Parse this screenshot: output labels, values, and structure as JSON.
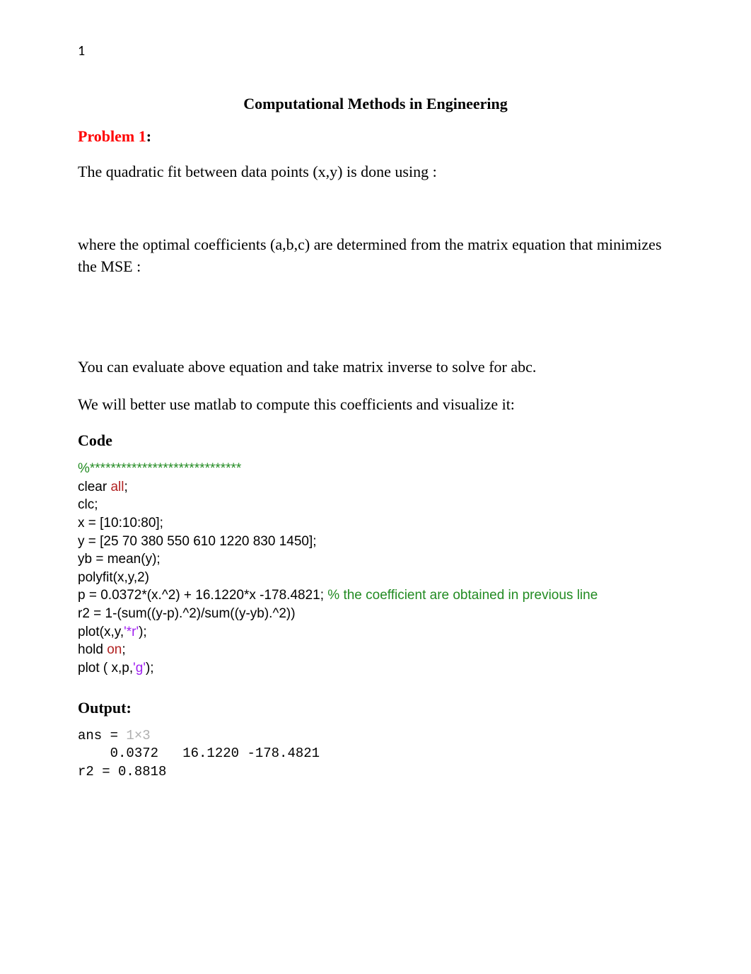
{
  "page_number": "1",
  "title": "Computational Methods in Engineering",
  "problem": {
    "label_red": "Problem 1",
    "label_black": ":"
  },
  "paragraphs": {
    "p1": "The quadratic fit between data points (x,y) is done using :",
    "p2": "where the optimal coefficients (a,b,c) are determined from the matrix equation that minimizes the MSE :",
    "p3": "You can evaluate above equation and take matrix inverse to solve for abc.",
    "p4": "We will better use matlab to compute this coefficients and visualize it:"
  },
  "code_heading": "Code",
  "code": {
    "l1": "%*****************************",
    "l2a": "clear ",
    "l2b": "all",
    "l2c": ";",
    "l3": "clc;",
    "l4": "x = [10:10:80];",
    "l5": "y = [25 70 380 550 610 1220 830 1450];",
    "l6": "yb = mean(y);",
    "l7": "polyfit(x,y,2)",
    "l8a": "p = 0.0372*(x.^2) + 16.1220*x -178.4821; ",
    "l8b": "% the coefficient are obtained in previous line",
    "l9": "r2 = 1-(sum((y-p).^2)/sum((y-yb).^2))",
    "l10a": "plot(x,y,",
    "l10b": "'*r'",
    "l10c": ");",
    "l11a": "hold ",
    "l11b": "on",
    "l11c": ";",
    "l12a": "plot ( x,p,",
    "l12b": "'g'",
    "l12c": ");"
  },
  "output_heading": "Output:",
  "output": {
    "l1a": "ans = ",
    "l1b": "1×3",
    "l2": "    0.0372   16.1220 -178.4821",
    "l3": "r2 = 0.8818"
  }
}
